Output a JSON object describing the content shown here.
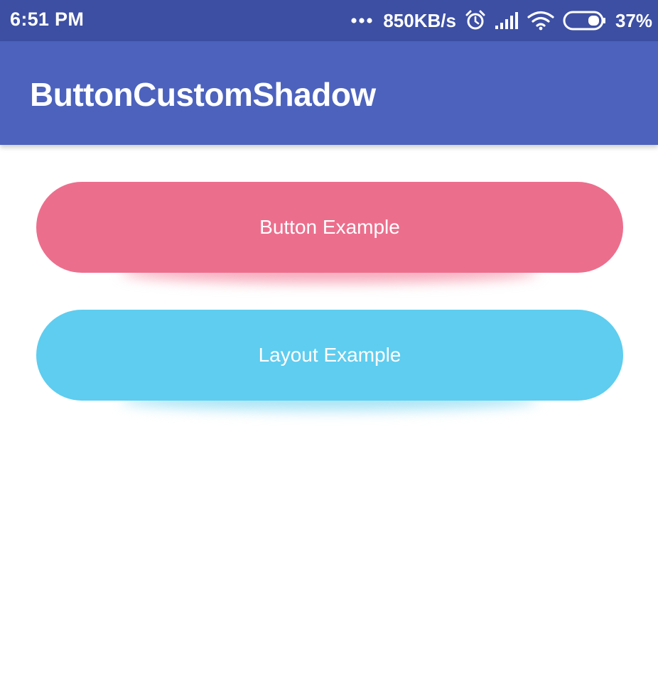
{
  "status_bar": {
    "time": "6:51 PM",
    "network_speed": "850KB/s",
    "battery_percent": "37%",
    "icons": [
      "more-dots-icon",
      "alarm-icon",
      "signal-icon",
      "wifi-icon",
      "battery-icon"
    ],
    "background": "#3d4fa3"
  },
  "app_bar": {
    "title": "ButtonCustomShadow",
    "background": "#4c62bd"
  },
  "main": {
    "button_example": {
      "label": "Button Example",
      "color": "#ec6e8d",
      "shadow_color": "#f7a9bb"
    },
    "layout_example": {
      "label": "Layout Example",
      "color": "#5ecdef",
      "shadow_color": "#a9e4f5"
    }
  }
}
